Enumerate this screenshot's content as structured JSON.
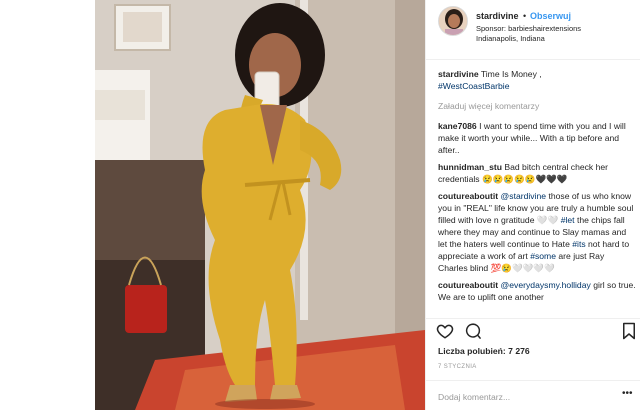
{
  "post": {
    "username": "stardivine",
    "dot": "•",
    "follow_label": "Obserwuj",
    "sponsor": "Sponsor: barbieshairextensions",
    "location": "Indianapolis, Indiana"
  },
  "caption": {
    "user": "stardivine",
    "text": "Time Is Money ,",
    "hashtag": "#WestCoastBarbie"
  },
  "load_more": "Załaduj więcej komentarzy",
  "comments": [
    {
      "user": "kane7086",
      "text": "I want to spend time with you and I will make it worth your while... With a tip before and after.."
    },
    {
      "user": "hunnidman_stu",
      "text": "Bad bitch central check her credentials 😢😢😢😢😢🖤🖤🖤"
    },
    {
      "user": "coutureaboutit",
      "mention": "@stardivine",
      "text": "those of us who know you in \"REAL\" life know you are truly a humble soul filled with love n gratitude 🤍🤍",
      "tag1": "#let",
      "text2": "the chips fall where they may and continue to Slay mamas and let the haters well continue to Hate",
      "tag2": "#its",
      "text3": "not hard to appreciate a work of art",
      "tag3": "#some",
      "text4": "are just Ray Charles blind 💯😢🤍🤍🤍🤍"
    },
    {
      "user": "coutureaboutit",
      "mention": "@everydaysmy.holliday",
      "text": "girl so true. We are to uplift one another"
    }
  ],
  "likes_label": "Liczba polubień: 7 276",
  "date": "7 STYCZNIA",
  "add_comment_placeholder": "Dodaj komentarz...",
  "more_icon_text": "•••",
  "icons": [
    "heart-icon",
    "comment-icon",
    "bookmark-icon",
    "more-options-icon"
  ]
}
